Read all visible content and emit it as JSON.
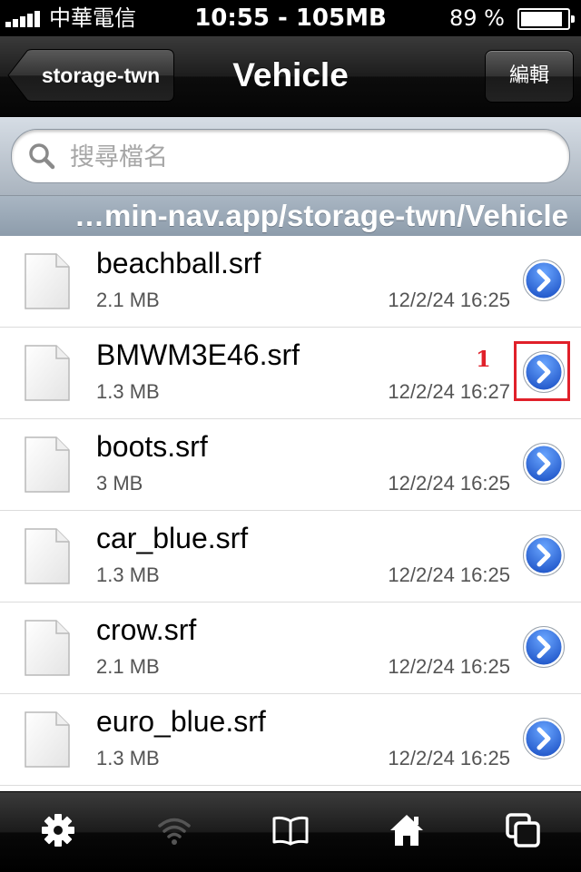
{
  "status_bar": {
    "carrier": "中華電信",
    "time_memory": "10:55 - 105MB",
    "battery_percent": "89 %",
    "battery_level": 0.89
  },
  "nav": {
    "back_label": "storage-twn",
    "title": "Vehicle",
    "edit_label": "編輯"
  },
  "search": {
    "placeholder": "搜尋檔名",
    "value": ""
  },
  "path": "…min-nav.app/storage-twn/Vehicle",
  "files": [
    {
      "name": "beachball.srf",
      "size": "2.1 MB",
      "date": "12/2/24 16:25"
    },
    {
      "name": "BMWM3E46.srf",
      "size": "1.3 MB",
      "date": "12/2/24 16:27"
    },
    {
      "name": "boots.srf",
      "size": "3 MB",
      "date": "12/2/24 16:25"
    },
    {
      "name": "car_blue.srf",
      "size": "1.3 MB",
      "date": "12/2/24 16:25"
    },
    {
      "name": "crow.srf",
      "size": "2.1 MB",
      "date": "12/2/24 16:25"
    },
    {
      "name": "euro_blue.srf",
      "size": "1.3 MB",
      "date": "12/2/24 16:25"
    }
  ],
  "annotation": {
    "label": "1",
    "color": "#e0202a"
  },
  "tabs": [
    {
      "icon": "gear-icon"
    },
    {
      "icon": "wifi-icon"
    },
    {
      "icon": "book-icon"
    },
    {
      "icon": "home-icon"
    },
    {
      "icon": "windows-icon"
    }
  ],
  "colors": {
    "accent_blue": "#1f63d8",
    "path_bar": "#9aa8b7",
    "nav_bar": "#1d1d1d"
  }
}
